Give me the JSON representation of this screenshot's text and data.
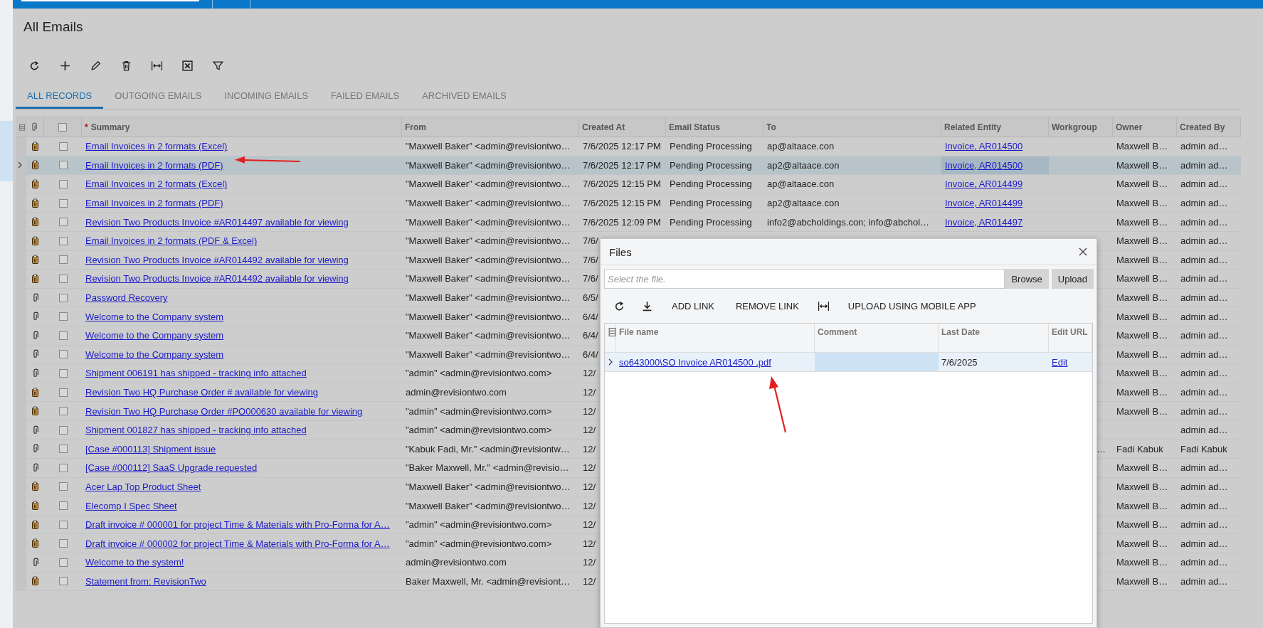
{
  "page": {
    "title": "All Emails"
  },
  "toolbar": [
    {
      "kind": "refresh"
    },
    {
      "kind": "add"
    },
    {
      "kind": "edit"
    },
    {
      "kind": "delete"
    },
    {
      "kind": "fit"
    },
    {
      "kind": "excel"
    },
    {
      "kind": "filter"
    }
  ],
  "tabs": [
    {
      "label": "ALL RECORDS",
      "selected": true
    },
    {
      "label": "OUTGOING EMAILS",
      "selected": false
    },
    {
      "label": "INCOMING EMAILS",
      "selected": false
    },
    {
      "label": "FAILED EMAILS",
      "selected": false
    },
    {
      "label": "ARCHIVED EMAILS",
      "selected": false
    }
  ],
  "table": {
    "select_all_checked": false,
    "columns": [
      {
        "label": "Summary",
        "mark": "*"
      },
      {
        "label": "From"
      },
      {
        "label": "Created At"
      },
      {
        "label": "Email Status"
      },
      {
        "label": "To"
      },
      {
        "label": "Related Entity"
      },
      {
        "label": "Workgroup"
      },
      {
        "label": "Owner"
      },
      {
        "label": "Created By"
      }
    ],
    "rows": [
      {
        "kind": "file",
        "selected": false,
        "checked": false,
        "summary": "Email Invoices in 2 formats (Excel)",
        "from": "\"Maxwell Baker\" <admin@revisiontwo…",
        "created_at": "7/6/2025 12:17 PM",
        "status": "Pending Processing",
        "to": "ap@altaace.con",
        "related": "Invoice, AR014500",
        "owner": "Maxwell B…",
        "created_by": "admin ad…"
      },
      {
        "kind": "file",
        "selected": true,
        "checked": false,
        "summary": "Email Invoices in 2 formats (PDF)",
        "from": "\"Maxwell Baker\" <admin@revisiontwo…",
        "created_at": "7/6/2025 12:17 PM",
        "status": "Pending Processing",
        "to": "ap2@altaace.con",
        "related": "Invoice, AR014500",
        "owner": "Maxwell B…",
        "created_by": "admin ad…"
      },
      {
        "kind": "file",
        "selected": false,
        "checked": false,
        "summary": "Email Invoices in 2 formats (Excel)",
        "from": "\"Maxwell Baker\" <admin@revisiontwo…",
        "created_at": "7/6/2025 12:15 PM",
        "status": "Pending Processing",
        "to": "ap@altaace.con",
        "related": "Invoice, AR014499",
        "owner": "Maxwell B…",
        "created_by": "admin ad…"
      },
      {
        "kind": "file",
        "selected": false,
        "checked": false,
        "summary": "Email Invoices in 2 formats (PDF)",
        "from": "\"Maxwell Baker\" <admin@revisiontwo…",
        "created_at": "7/6/2025 12:15 PM",
        "status": "Pending Processing",
        "to": "ap2@altaace.con",
        "related": "Invoice, AR014499",
        "owner": "Maxwell B…",
        "created_by": "admin ad…"
      },
      {
        "kind": "file",
        "selected": false,
        "checked": false,
        "summary": "Revision Two Products Invoice #AR014497 available for viewing",
        "from": "\"Maxwell Baker\" <admin@revisiontwo…",
        "created_at": "7/6/2025 12:09 PM",
        "status": "Pending Processing",
        "to": "info2@abcholdings.con; info@abchol…",
        "related": "Invoice, AR014497",
        "owner": "Maxwell B…",
        "created_by": "admin ad…"
      },
      {
        "kind": "file",
        "selected": false,
        "checked": false,
        "summary": "Email Invoices in 2 formats (PDF & Excel)",
        "from": "\"Maxwell Baker\" <admin@revisiontwo…",
        "created_at": "7/6/",
        "owner": "Maxwell B…",
        "created_by": "admin ad…"
      },
      {
        "kind": "file",
        "selected": false,
        "checked": false,
        "summary": "Revision Two Products Invoice #AR014492 available for viewing",
        "from": "\"Maxwell Baker\" <admin@revisiontwo…",
        "created_at": "7/6/",
        "owner": "Maxwell B…",
        "created_by": "admin ad…"
      },
      {
        "kind": "file",
        "selected": false,
        "checked": false,
        "summary": "Revision Two Products Invoice #AR014492 available for viewing",
        "from": "\"Maxwell Baker\" <admin@revisiontwo…",
        "created_at": "7/6/",
        "owner": "Maxwell B…",
        "created_by": "admin ad…"
      },
      {
        "kind": "clip",
        "selected": false,
        "checked": false,
        "summary": "Password Recovery",
        "from": "\"Maxwell Baker\" <admin@revisiontwo…",
        "created_at": "6/5/",
        "owner": "Maxwell B…",
        "created_by": "admin ad…"
      },
      {
        "kind": "clip",
        "selected": false,
        "checked": false,
        "summary": "Welcome to the Company system",
        "from": "\"Maxwell Baker\" <admin@revisiontwo…",
        "created_at": "6/4/",
        "owner": "Maxwell B…",
        "created_by": "admin ad…"
      },
      {
        "kind": "clip",
        "selected": false,
        "checked": false,
        "summary": "Welcome to the Company system",
        "from": "\"Maxwell Baker\" <admin@revisiontwo…",
        "created_at": "6/4/",
        "owner": "Maxwell B…",
        "created_by": "admin ad…"
      },
      {
        "kind": "clip",
        "selected": false,
        "checked": false,
        "summary": "Welcome to the Company system",
        "from": "\"Maxwell Baker\" <admin@revisiontwo…",
        "created_at": "6/4/",
        "owner": "Maxwell B…",
        "created_by": "admin ad…"
      },
      {
        "kind": "clip",
        "selected": false,
        "checked": false,
        "summary": "Shipment 006191 has shipped - tracking info attached",
        "from": "\"admin\" <admin@revisiontwo.com>",
        "created_at": "12/",
        "owner": "Maxwell B…",
        "created_by": "admin ad…"
      },
      {
        "kind": "file",
        "selected": false,
        "checked": false,
        "summary": "Revision Two HQ Purchase Order # available for viewing",
        "from": "admin@revisiontwo.com",
        "created_at": "12/",
        "owner": "Maxwell B…",
        "created_by": "admin ad…"
      },
      {
        "kind": "file",
        "selected": false,
        "checked": false,
        "summary": "Revision Two HQ Purchase Order #PO000630 available for viewing",
        "from": "\"admin\" <admin@revisiontwo.com>",
        "created_at": "12/",
        "owner": "Maxwell B…",
        "created_by": "admin ad…"
      },
      {
        "kind": "clip",
        "selected": false,
        "checked": false,
        "summary": "Shipment 001827 has shipped - tracking info attached",
        "from": "\"admin\" <admin@revisiontwo.com>",
        "created_at": "12/",
        "created_by": "admin ad…"
      },
      {
        "kind": "clip",
        "selected": false,
        "checked": false,
        "summary": "[Case #000113] Shipment issue",
        "from": "\"Kabuk Fadi, Mr.\" <admin@revisiontw…",
        "created_at": "12/",
        "workgroup": "…",
        "owner": "Fadi Kabuk",
        "created_by": "Fadi Kabuk"
      },
      {
        "kind": "clip",
        "selected": false,
        "checked": false,
        "summary": "[Case #000112] SaaS Upgrade requested",
        "from": "\"Baker Maxwell, Mr.\" <admin@revisio…",
        "created_at": "12/",
        "owner": "Maxwell B…",
        "created_by": "admin ad…"
      },
      {
        "kind": "file",
        "selected": false,
        "checked": false,
        "summary": "Acer Lap Top Product Sheet",
        "from": "\"Maxwell Baker\" <admin@revisiontwo…",
        "created_at": "12/",
        "owner": "Maxwell B…",
        "created_by": "admin ad…"
      },
      {
        "kind": "file",
        "selected": false,
        "checked": false,
        "summary": "Elecomp I Spec Sheet",
        "from": "\"Maxwell Baker\" <admin@revisiontwo…",
        "created_at": "12/",
        "owner": "Maxwell B…",
        "created_by": "admin ad…"
      },
      {
        "kind": "file",
        "selected": false,
        "checked": false,
        "summary": "Draft invoice # 000001 for project Time & Materials with Pro-Forma for A…",
        "from": "\"admin\" <admin@revisiontwo.com>",
        "created_at": "12/",
        "owner": "Maxwell B…",
        "created_by": "admin ad…"
      },
      {
        "kind": "file",
        "selected": false,
        "checked": false,
        "summary": "Draft invoice # 000002 for project Time & Materials with Pro-Forma for A…",
        "from": "\"admin\" <admin@revisiontwo.com>",
        "created_at": "12/",
        "owner": "Maxwell B…",
        "created_by": "admin ad…"
      },
      {
        "kind": "clip",
        "selected": false,
        "checked": false,
        "summary": "Welcome to the system!",
        "from": "admin@revisiontwo.com",
        "created_at": "12/",
        "owner": "Maxwell B…",
        "created_by": "admin ad…"
      },
      {
        "kind": "file",
        "selected": false,
        "checked": false,
        "summary": "Statement from: RevisionTwo",
        "from": "Baker Maxwell, Mr. <admin@revisiont…",
        "created_at": "12/",
        "owner": "Maxwell B…",
        "created_by": "admin ad…"
      }
    ]
  },
  "dialog": {
    "title": "Files",
    "file_field": {
      "placeholder": "Select the file."
    },
    "browse_button": "Browse",
    "upload_button": "Upload",
    "toolbar": [
      {
        "kind": "refresh"
      },
      {
        "kind": "download"
      },
      {
        "kind": "text",
        "label": "ADD LINK"
      },
      {
        "kind": "text",
        "label": "REMOVE LINK"
      },
      {
        "kind": "fit"
      },
      {
        "kind": "text",
        "label": "UPLOAD USING MOBILE APP"
      }
    ],
    "columns": [
      "File name",
      "Comment",
      "Last Date",
      "Edit URL"
    ],
    "rows": [
      {
        "file_name": "so643000\\SO Invoice AR014500 .pdf",
        "last_date": "7/6/2025",
        "edit": "Edit",
        "selected": true
      }
    ]
  }
}
